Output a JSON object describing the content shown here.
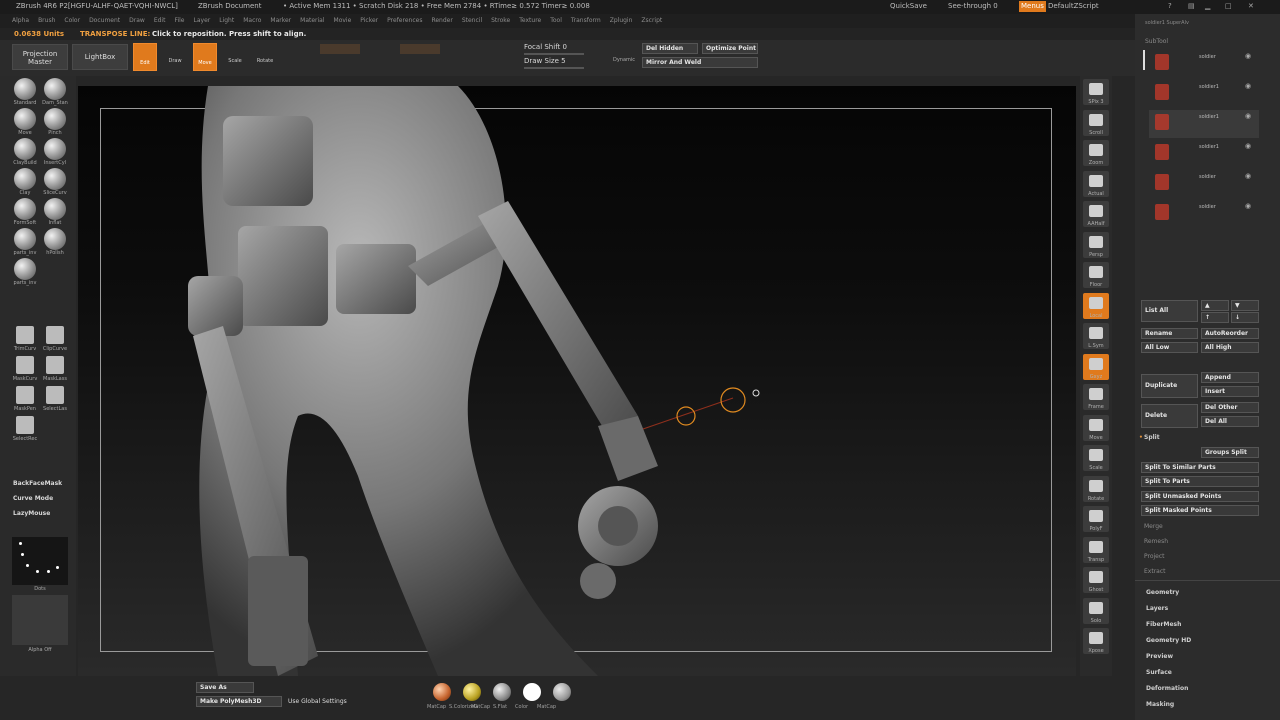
{
  "titlebar": {
    "app": "ZBrush 4R6 P2[HGFU-ALHF-QAET-VQHI-NWCL]",
    "document": "ZBrush Document",
    "stats": "• Active Mem 1311 • Scratch Disk 218 • Free Mem 2784 • RTime≥ 0.572 Timer≥ 0.008",
    "quicksave": "QuickSave",
    "see_through": "See-through 0",
    "menus": "Menus",
    "script": "DefaultZScript"
  },
  "menubar": {
    "items": [
      "Alpha",
      "Brush",
      "Color",
      "Document",
      "Draw",
      "Edit",
      "File",
      "Layer",
      "Light",
      "Macro",
      "Marker",
      "Material",
      "Movie",
      "Picker",
      "Preferences",
      "Render",
      "Stencil",
      "Stroke",
      "Texture",
      "Tool",
      "Transform",
      "Zplugin",
      "Zscript"
    ]
  },
  "infobar": {
    "units": "0.0638 Units",
    "mode": "TRANSPOSE LINE:",
    "hint": "Click to reposition. Press shift to align."
  },
  "toolbar": {
    "projection_master": "Projection Master",
    "lightbox": "LightBox",
    "edit": "Edit",
    "draw": "Draw",
    "move": "Move",
    "scale": "Scale",
    "rotate": "Rotate",
    "focal_shift": "Focal Shift 0",
    "draw_size": "Draw Size 5",
    "dynamic": "Dynamic",
    "del_hidden": "Del Hidden",
    "optimize_point": "Optimize Point",
    "mirror_and_weld": "Mirror And Weld"
  },
  "left_shelf": {
    "brushes": [
      "Standard",
      "Dam_Stan",
      "Move",
      "Pinch",
      "ClayBuild",
      "InsertCyl",
      "Clay",
      "SliceCurv",
      "FormSoft",
      "Inflat",
      "parts_inv",
      "hPolish",
      "parts_inv"
    ],
    "curves": [
      "TrimCurv",
      "ClipCurve",
      "MaskCurv",
      "MaskLass",
      "MaskPen",
      "SelectLas",
      "SelectRec"
    ],
    "backface_mask": "BackFaceMask",
    "curve_mode": "Curve Mode",
    "lazy_mouse": "LazyMouse",
    "stroke_label": "Dots",
    "alpha_label": "Alpha Off"
  },
  "right_shelf": {
    "items": [
      "SPix 3",
      "Scroll",
      "Zoom",
      "Actual",
      "AAHalf",
      "Persp",
      "Floor",
      "Local",
      "L.Sym",
      "Gxyz",
      "Frame",
      "Move",
      "Scale",
      "Rotate",
      "PolyF",
      "Transp",
      "Ghost",
      "Solo",
      "Xpose"
    ]
  },
  "panel": {
    "header": "soldier1  SuperAlv",
    "subtool_title": "SubTool",
    "subtools": [
      "soldier",
      "soldier1",
      "soldier1",
      "soldier1",
      "soldier",
      "soldier"
    ],
    "list_all": "List All",
    "rename": "Rename",
    "autoreorder": "AutoReorder",
    "all_low": "All Low",
    "all_high": "All High",
    "duplicate": "Duplicate",
    "append": "Append",
    "insert": "Insert",
    "delete": "Delete",
    "del_other": "Del Other",
    "del_all": "Del All",
    "split": "Split",
    "groups_split": "Groups Split",
    "split_similar": "Split To Similar Parts",
    "split_parts": "Split To Parts",
    "split_unmasked": "Split Unmasked Points",
    "split_masked": "Split Masked Points",
    "merge": "Merge",
    "remesh": "Remesh",
    "project": "Project",
    "extract": "Extract",
    "sections": [
      "Geometry",
      "Layers",
      "FiberMesh",
      "Geometry HD",
      "Preview",
      "Surface",
      "Deformation",
      "Masking"
    ]
  },
  "bottombar": {
    "save_as": "Save As",
    "make_polymesh": "Make PolyMesh3D",
    "use_global": "Use Global Settings",
    "materials": [
      "MatCap",
      "S.ColorizeG",
      "MatCap",
      "S.Flat",
      "Color",
      "MatCap"
    ]
  },
  "colors": {
    "accent": "#e07a1d",
    "panel_bg": "#2c2c2c",
    "button_bg": "#3a3a3a"
  }
}
